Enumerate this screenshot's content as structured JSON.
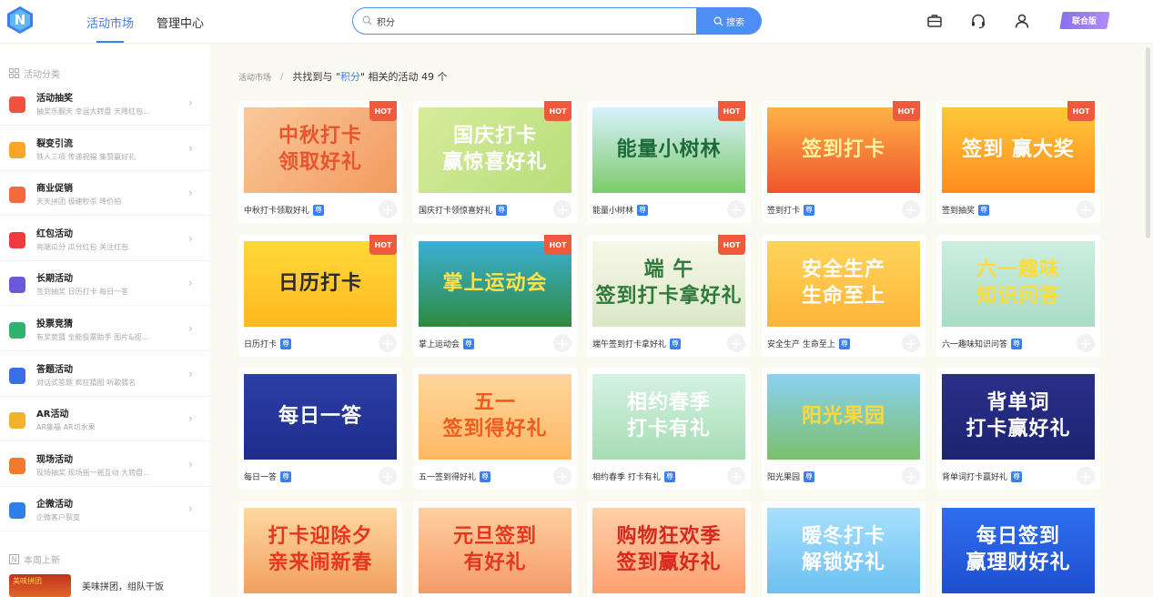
{
  "header": {
    "logo_letter": "N",
    "tabs": [
      {
        "label": "活动市场",
        "active": true
      },
      {
        "label": "管理中心",
        "active": false
      }
    ],
    "search": {
      "value": "积分",
      "button_label": "搜索"
    },
    "edition_label": "联合版"
  },
  "sidebar": {
    "category_title": "活动分类",
    "items": [
      {
        "title": "活动抽奖",
        "sub": "抽奖乐翻天   幸运大转盘   天降红包...",
        "icon": "gift-icon",
        "color": "#f0533c"
      },
      {
        "title": "裂变引流",
        "sub": "铁人三项   传递祝福   集赞赢好礼",
        "icon": "user-share-icon",
        "color": "#f7a629"
      },
      {
        "title": "商业促销",
        "sub": "天天拼团   极速秒杀   降价拍",
        "icon": "tag-icon",
        "color": "#f56a3c"
      },
      {
        "title": "红包活动",
        "sub": "亮端瓜分   瓜分红包   关注红包",
        "icon": "red-envelope-icon",
        "color": "#ee3b3b"
      },
      {
        "title": "长期活动",
        "sub": "签到抽奖   日历打卡   每日一答",
        "icon": "calendar-icon",
        "color": "#6a5ad8"
      },
      {
        "title": "投票竞猜",
        "sub": "有奖竞猜   全能投票助手   图片&视...",
        "icon": "vote-check-icon",
        "color": "#2fb36e"
      },
      {
        "title": "答题活动",
        "sub": "对话式答题   疯狂猜图   听歌猜名",
        "icon": "question-icon",
        "color": "#3a6fe3"
      },
      {
        "title": "AR活动",
        "sub": "AR集福   AR切水果",
        "icon": "robot-icon",
        "color": "#f4b12b"
      },
      {
        "title": "现场活动",
        "sub": "现场抽奖   现场摇一摇互动   大转盘...",
        "icon": "grid-icon",
        "color": "#f27a2c"
      },
      {
        "title": "企微活动",
        "sub": "企微客户裂变",
        "icon": "wecom-icon",
        "color": "#2f7fe6"
      }
    ],
    "new_title": "本周上新",
    "new_item": {
      "thumb_label": "美味拼团",
      "text": "美味拼团，组队干饭"
    }
  },
  "breadcrumb": {
    "root": "活动市场",
    "sep": "/",
    "prefix": "共找到与 \" ",
    "keyword": "积分",
    "suffix": " \" 相关的活动 49 个"
  },
  "cards": [
    {
      "name": "中秋打卡领取好礼",
      "banner": "中秋打卡\n领取好礼",
      "hot": true,
      "bg": "linear-gradient(135deg,#f9c99b,#f39a5e)",
      "fg": "#e8542d"
    },
    {
      "name": "国庆打卡领惊喜好礼",
      "banner": "国庆打卡\n赢惊喜好礼",
      "hot": true,
      "bg": "linear-gradient(135deg,#d6ec9a,#b8dd7a)",
      "fg": "#ffffff"
    },
    {
      "name": "能量小树林",
      "banner": "能量小树林",
      "hot": true,
      "bg": "linear-gradient(180deg,#d8f1ff,#7ccb6a)",
      "fg": "#1d6a3a"
    },
    {
      "name": "签到打卡",
      "banner": "签到打卡",
      "hot": true,
      "bg": "linear-gradient(180deg,#ffb347,#f0552c)",
      "fg": "#fff3a0"
    },
    {
      "name": "签到抽奖",
      "banner": "签到 赢大奖",
      "hot": true,
      "bg": "linear-gradient(180deg,#ffc83a,#ff8c1e)",
      "fg": "#ffffff"
    },
    {
      "name": "日历打卡",
      "banner": "日历打卡",
      "hot": true,
      "bg": "linear-gradient(180deg,#ffd93a,#ffb81e)",
      "fg": "#2b2b2b"
    },
    {
      "name": "掌上运动会",
      "banner": "掌上运动会",
      "hot": true,
      "bg": "linear-gradient(180deg,#3bb0d8,#2f8a3e)",
      "fg": "#ffe24a"
    },
    {
      "name": "端午签到打卡拿好礼",
      "banner": "端 午\n签到打卡拿好礼",
      "hot": true,
      "bg": "linear-gradient(180deg,#f7f7e8,#d9e8c6)",
      "fg": "#2e7a3a"
    },
    {
      "name": "安全生产 生命至上",
      "banner": "安全生产\n生命至上",
      "hot": false,
      "bg": "linear-gradient(180deg,#ffd45a,#ffb43a)",
      "fg": "#ffffff"
    },
    {
      "name": "六一趣味知识问答",
      "banner": "六一趣味\n知识问答",
      "hot": false,
      "bg": "linear-gradient(180deg,#cdeee0,#a8dcc6)",
      "fg": "#ffdc3a"
    },
    {
      "name": "每日一答",
      "banner": "每日一答",
      "hot": false,
      "bg": "linear-gradient(180deg,#2c3ea8,#1f2d8a)",
      "fg": "#ffffff"
    },
    {
      "name": "五一签到得好礼",
      "banner": "五一\n签到得好礼",
      "hot": false,
      "bg": "linear-gradient(180deg,#ffd79a,#ffb866)",
      "fg": "#f05a1e"
    },
    {
      "name": "相约春季 打卡有礼",
      "banner": "相约春季\n打卡有礼",
      "hot": false,
      "bg": "linear-gradient(180deg,#d5f2e2,#a6dcb4)",
      "fg": "#ffffff"
    },
    {
      "name": "阳光果园",
      "banner": "阳光果园",
      "hot": false,
      "bg": "linear-gradient(180deg,#8bd1f5,#7bc06a)",
      "fg": "#ffd83a"
    },
    {
      "name": "背单词打卡赢好礼",
      "banner": "背单词\n打卡赢好礼",
      "hot": false,
      "bg": "linear-gradient(180deg,#2b2f8a,#1c2470)",
      "fg": "#ffffff"
    },
    {
      "name": "",
      "banner": "打卡迎除夕\n亲来闹新春",
      "hot": false,
      "bg": "linear-gradient(180deg,#ffd8a0,#f0a060)",
      "fg": "#e8361e"
    },
    {
      "name": "",
      "banner": "元旦签到\n有好礼",
      "hot": false,
      "bg": "linear-gradient(180deg,#ffd0a0,#f59a6a)",
      "fg": "#e8361e"
    },
    {
      "name": "",
      "banner": "购物狂欢季\n签到赢好礼",
      "hot": false,
      "bg": "linear-gradient(180deg,#ffd0a8,#ffa070)",
      "fg": "#d6281e"
    },
    {
      "name": "",
      "banner": "暖冬打卡\n解锁好礼",
      "hot": false,
      "bg": "linear-gradient(180deg,#a8e0ff,#6cc0f0)",
      "fg": "#ffffff"
    },
    {
      "name": "",
      "banner": "每日签到\n赢理财好礼",
      "hot": false,
      "bg": "linear-gradient(180deg,#2e6ef0,#1e4fd0)",
      "fg": "#ffffff"
    }
  ],
  "hot_label": "HOT",
  "vip_label": "尊",
  "add_label": "+"
}
